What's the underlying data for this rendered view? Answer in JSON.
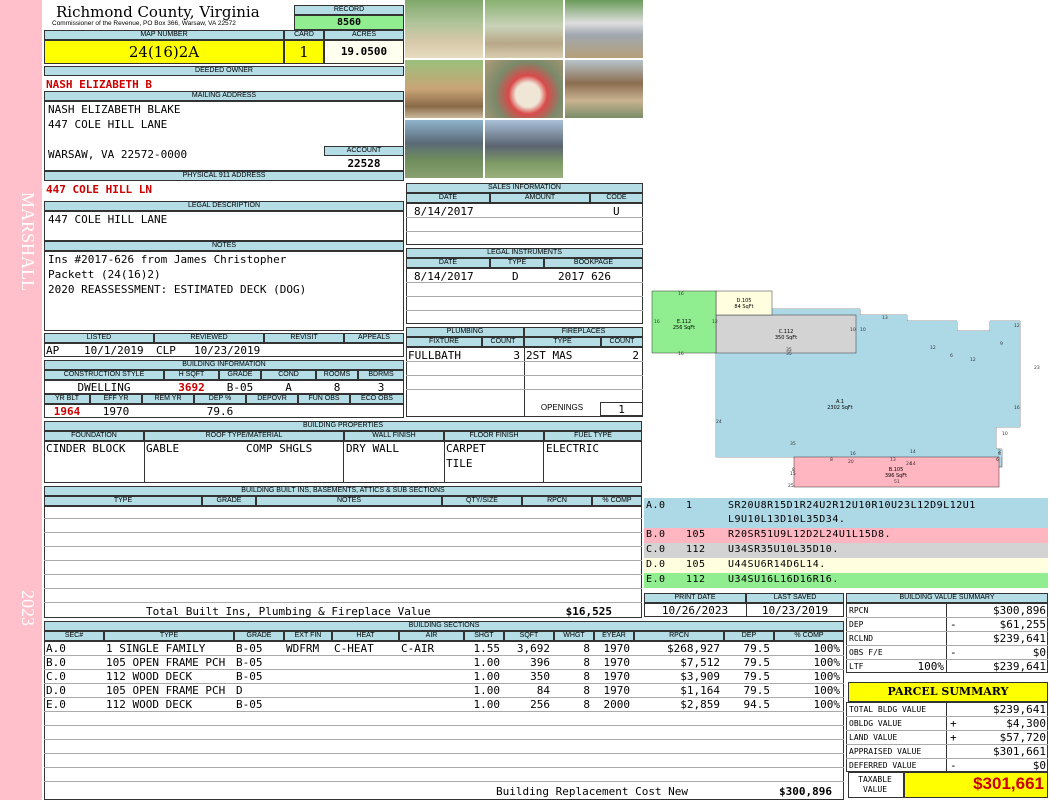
{
  "sidebar": {
    "name": "MARSHALL",
    "year": "2023"
  },
  "header": {
    "county": "Richmond County, Virginia",
    "commissioner": "Commissioner of the Revenue, PO Box 366, Warsaw, VA 22572",
    "record_label": "RECORD",
    "record": "8560"
  },
  "parcel": {
    "map_label": "MAP NUMBER",
    "map_number": "24(16)2A",
    "card_label": "CARD",
    "card": "1",
    "acres_label": "ACRES",
    "acres": "19.0500"
  },
  "owner": {
    "deeded_label": "DEEDED OWNER",
    "deeded": "NASH ELIZABETH B",
    "mailing_label": "MAILING ADDRESS",
    "mail1": "NASH ELIZABETH BLAKE",
    "mail2": "447 COLE HILL LANE",
    "mail3": "WARSAW, VA 22572-0000",
    "account_label": "ACCOUNT",
    "account": "22528"
  },
  "address": {
    "label": "PHYSICAL 911 ADDRESS",
    "value": "447 COLE HILL LN"
  },
  "legal": {
    "label": "LEGAL DESCRIPTION",
    "value": "447 COLE HILL LANE"
  },
  "notes": {
    "label": "NOTES",
    "lines": [
      "Ins #2017-626 from James Christopher",
      "Packett (24(16)2)",
      "2020 REASSESSMENT: ESTIMATED DECK (DOG)"
    ]
  },
  "status": {
    "listed_label": "LISTED",
    "reviewed_label": "REVIEWED",
    "revisit_label": "REVISIT",
    "appeals_label": "APPEALS",
    "listed_by": "AP",
    "listed_date": "10/1/2019",
    "reviewed_by": "CLP",
    "reviewed_date": "10/23/2019"
  },
  "bldg": {
    "label": "BUILDING INFORMATION",
    "h_style": "CONSTRUCTION STYLE",
    "h_hsqft": "H SQFT",
    "h_grade": "GRADE",
    "h_cond": "COND",
    "h_rooms": "ROOMS",
    "h_bdrms": "BDRMS",
    "style": "DWELLING",
    "hsqft": "3692",
    "grade": "B-05",
    "cond": "A",
    "rooms": "8",
    "bdrms": "3",
    "h_yrblt": "YR BLT",
    "h_effyr": "EFF YR",
    "h_remyr": "REM YR",
    "h_dep": "DEP %",
    "h_depovr": "DEPOVR",
    "h_funobs": "FUN OBS",
    "h_ecoobs": "ECO OBS",
    "yrblt": "1964",
    "effyr": "1970",
    "dep": "79.6"
  },
  "props": {
    "label": "BUILDING PROPERTIES",
    "h_found": "FOUNDATION",
    "h_roof": "ROOF TYPE/MATERIAL",
    "h_wall": "WALL FINISH",
    "h_floor": "FLOOR FINISH",
    "h_fuel": "FUEL TYPE",
    "found": "CINDER BLOCK",
    "roof1": "GABLE",
    "roof2": "COMP SHGLS",
    "wall": "DRY WALL",
    "floor1": "CARPET",
    "floor2": "TILE",
    "fuel": "ELECTRIC"
  },
  "builtins": {
    "label": "BUILDING BUILT INS, BASEMENTS, ATTICS & SUB SECTIONS",
    "h_type": "TYPE",
    "h_grade": "GRADE",
    "h_notes": "NOTES",
    "h_qty": "QTY/SIZE",
    "h_rpcn": "RPCN",
    "h_comp": "% COMP",
    "total_label": "Total Built Ins, Plumbing & Fireplace Value",
    "total": "$16,525"
  },
  "sales": {
    "label": "SALES INFORMATION",
    "h_date": "DATE",
    "h_amount": "AMOUNT",
    "h_code": "CODE",
    "date": "8/14/2017",
    "code": "U"
  },
  "instruments": {
    "label": "LEGAL INSTRUMENTS",
    "h_date": "DATE",
    "h_type": "TYPE",
    "h_book": "BOOKPAGE",
    "date": "8/14/2017",
    "type": "D",
    "book": "2017 626"
  },
  "plumbing": {
    "label": "PLUMBING",
    "h_fixture": "FIXTURE",
    "h_count": "COUNT",
    "fixture": "FULLBATH",
    "count": "3"
  },
  "fireplaces": {
    "label": "FIREPLACES",
    "h_type": "TYPE",
    "h_count": "COUNT",
    "type": "2ST MAS",
    "count": "2",
    "openings_label": "OPENINGS",
    "openings": "1"
  },
  "sketch": {
    "labels": {
      "a_area": "A.1",
      "a_sqft": "2302 SqFt",
      "b_area": "B.105",
      "b_sqft": "396 SqFt",
      "c_area": "C.112",
      "c_sqft": "350 SqFt",
      "d_area": "D.105",
      "d_sqft": "84 SqFt",
      "e_area": "E.112",
      "e_sqft": "256 SqFt"
    },
    "colors": {
      "a": "#add8e6",
      "b": "#ffb6c1",
      "c": "#d3d3d3",
      "d": "#ffffe0",
      "e": "#90ee90"
    },
    "dims": [
      "16",
      "16",
      "16",
      "12",
      "10",
      "10",
      "13",
      "12",
      "12",
      "9",
      "6",
      "12",
      "23",
      "16",
      "10",
      "24",
      "35",
      "35",
      "35",
      "25",
      "15",
      "8",
      "8",
      "6",
      "24",
      "2",
      "13",
      "8",
      "51",
      "16",
      "20",
      "14",
      "14"
    ]
  },
  "segments": [
    {
      "sec": "A.0",
      "code": "1",
      "text": "SR20U8R15D1R24U2R12U10R10U23L12D9L12U1",
      "text2": "L9U10L13D10L35D34.",
      "color": "#add8e6"
    },
    {
      "sec": "B.0",
      "code": "105",
      "text": "R20SR51U9L12D2L24U1L15D8.",
      "color": "#ffb6c1"
    },
    {
      "sec": "C.0",
      "code": "112",
      "text": "U34SR35U10L35D10.",
      "color": "#d3d3d3"
    },
    {
      "sec": "D.0",
      "code": "105",
      "text": "U44SU6R14D6L14.",
      "color": "#ffffe0"
    },
    {
      "sec": "E.0",
      "code": "112",
      "text": "U34SU16L16D16R16.",
      "color": "#90ee90"
    }
  ],
  "dates": {
    "print_label": "PRINT DATE",
    "saved_label": "LAST SAVED",
    "print": "10/26/2023",
    "saved": "10/23/2019"
  },
  "sections": {
    "label": "BUILDING SECTIONS",
    "headers": [
      "SEC#",
      "TYPE",
      "GRADE",
      "EXT FIN",
      "HEAT",
      "AIR",
      "SHGT",
      "SQFT",
      "WHGT",
      "EYEAR",
      "RPCN",
      "DEP",
      "% COMP"
    ],
    "rows": [
      [
        "A.0",
        "1 SINGLE FAMILY",
        "B-05",
        "WDFRM",
        "C-HEAT",
        "C-AIR",
        "1.55",
        "3,692",
        "8",
        "1970",
        "$268,927",
        "79.5",
        "100%"
      ],
      [
        "B.0",
        "105 OPEN FRAME PCH",
        "B-05",
        "",
        "",
        "",
        "1.00",
        "396",
        "8",
        "1970",
        "$7,512",
        "79.5",
        "100%"
      ],
      [
        "C.0",
        "112 WOOD DECK",
        "B-05",
        "",
        "",
        "",
        "1.00",
        "350",
        "8",
        "1970",
        "$3,909",
        "79.5",
        "100%"
      ],
      [
        "D.0",
        "105 OPEN FRAME PCH",
        "D",
        "",
        "",
        "",
        "1.00",
        "84",
        "8",
        "1970",
        "$1,164",
        "79.5",
        "100%"
      ],
      [
        "E.0",
        "112 WOOD DECK",
        "B-05",
        "",
        "",
        "",
        "1.00",
        "256",
        "8",
        "2000",
        "$2,859",
        "94.5",
        "100%"
      ]
    ],
    "total_label": "Building Replacement Cost New",
    "total": "$300,896"
  },
  "bvs": {
    "label": "BUILDING VALUE SUMMARY",
    "rpcn_l": "RPCN",
    "rpcn": "$300,896",
    "dep_l": "DEP",
    "dep_s": "-",
    "dep": "$61,255",
    "rclnd_l": "RCLND",
    "rclnd": "$239,641",
    "obs_l": "OBS F/E",
    "obs_s": "-",
    "obs": "$0",
    "ltf_l": "LTF",
    "ltf_p": "100%",
    "ltf": "$239,641"
  },
  "summary": {
    "label": "PARCEL SUMMARY",
    "bldg_l": "TOTAL BLDG VALUE",
    "bldg": "$239,641",
    "obldg_l": "OBLDG VALUE",
    "obldg_s": "+",
    "obldg": "$4,300",
    "land_l": "LAND VALUE",
    "land_s": "+",
    "land": "$57,720",
    "appr_l": "APPRAISED VALUE",
    "appr": "$301,661",
    "def_l": "DEFERRED VALUE",
    "def_s": "-",
    "def": "$0",
    "tax_l1": "TAXABLE",
    "tax_l2": "VALUE",
    "tax": "$301,661"
  }
}
